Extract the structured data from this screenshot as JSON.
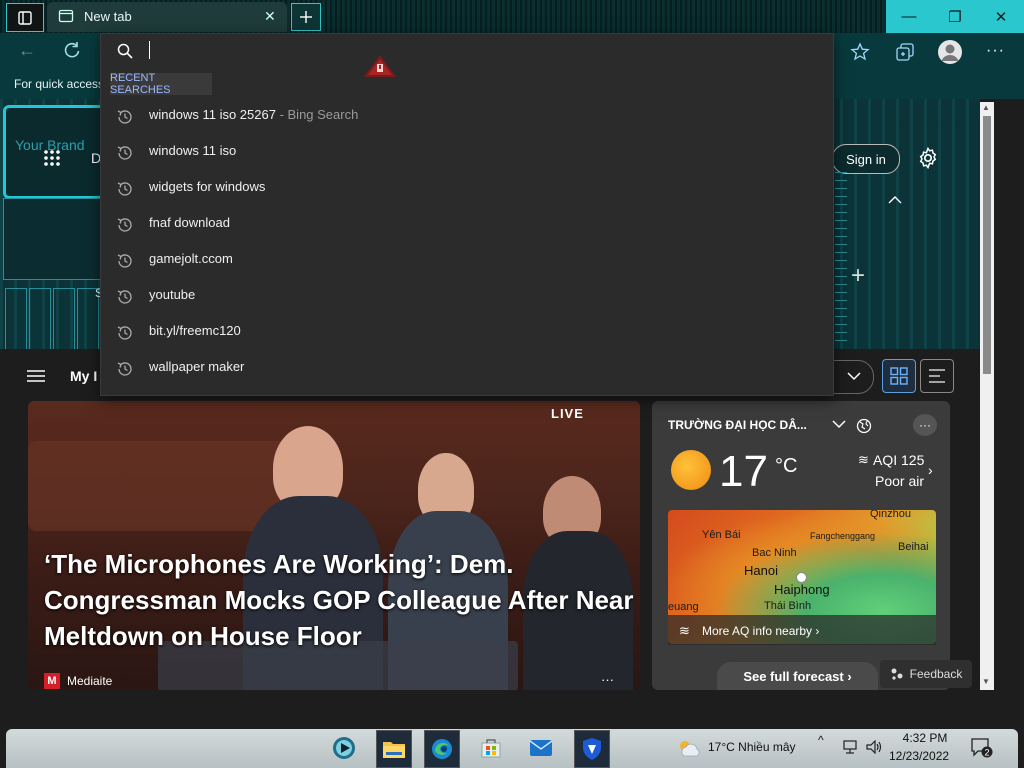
{
  "browser": {
    "tab_title": "New tab",
    "favorites_bar_text": "For quick access"
  },
  "address_dropdown": {
    "section_label": "RECENT SEARCHES",
    "items": [
      {
        "text": "windows 11 iso 25267",
        "suffix": " - Bing Search"
      },
      {
        "text": "windows 11 iso",
        "suffix": ""
      },
      {
        "text": "widgets for windows",
        "suffix": ""
      },
      {
        "text": "fnaf download",
        "suffix": ""
      },
      {
        "text": "gamejolt.ccom",
        "suffix": ""
      },
      {
        "text": "youtube",
        "suffix": ""
      },
      {
        "text": "bit.yl/freemc120",
        "suffix": ""
      },
      {
        "text": "wallpaper maker",
        "suffix": ""
      }
    ]
  },
  "page": {
    "sign_in_label": "Sign in",
    "feed_label_fragment": "My I",
    "letter_d": "D",
    "letter_s": "S",
    "brand_text": "Your Brand"
  },
  "hero": {
    "live_badge": "LIVE",
    "title": "‘The Microphones Are Working’: Dem. Congressman Mocks GOP Colleague After Near Meltdown on House Floor",
    "source_logo": "M",
    "source": "Mediaite",
    "more": "···"
  },
  "weather": {
    "location": "TRƯỜNG ĐẠI HỌC DÂ...",
    "temperature": "17",
    "unit": "°C",
    "aqi": "AQI 125",
    "aqi_label": "Poor air",
    "more_aq": "More AQ info nearby ›",
    "forecast_button": "See full forecast ›",
    "map_labels": {
      "qinzhou": "Qinzhou",
      "yen_bai": "Yên Bái",
      "fangchenggang": "Fangchenggang",
      "beihai": "Beihai",
      "bac_ninh": "Bac Ninh",
      "hanoi": "Hanoi",
      "haiphong": "Haiphong",
      "thai_binh": "Thái Bình",
      "euang": "euang"
    }
  },
  "feedback_label": "Feedback",
  "taskbar": {
    "weather_text": "17°C  Nhiều mây",
    "time": "4:32 PM",
    "date": "12/23/2022",
    "notification_count": "2"
  },
  "colors": {
    "accent_teal": "#2ac7cf",
    "dropdown_bg": "#2b2b2b",
    "recent_label": "#9ab8ff"
  }
}
